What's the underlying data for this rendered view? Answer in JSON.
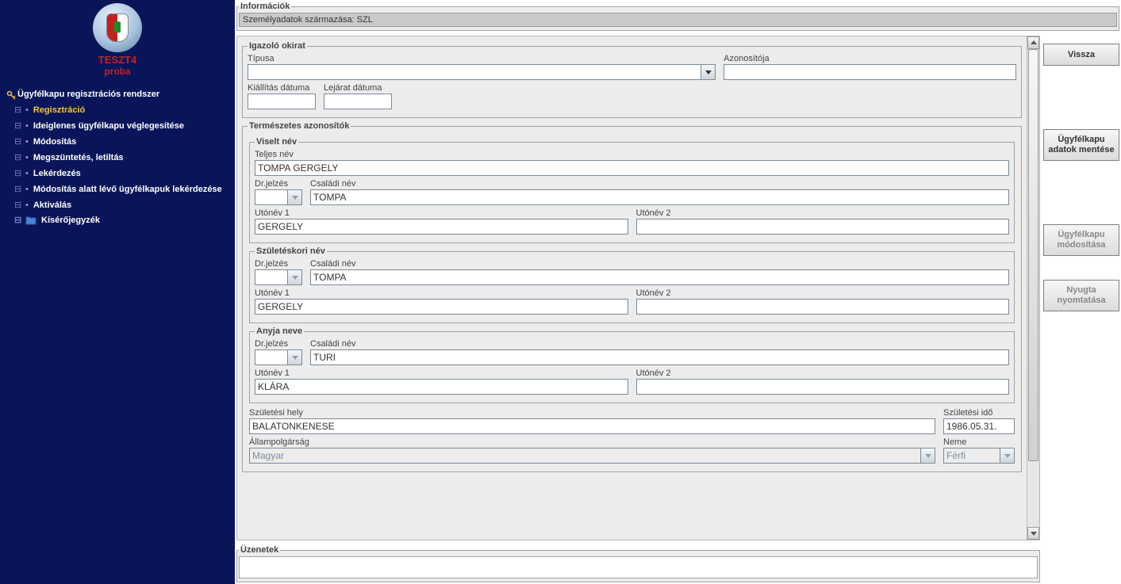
{
  "app": {
    "title1": "TESZT4",
    "title2": "proba"
  },
  "nav": {
    "root": "Ügyfélkapu regisztrációs rendszer",
    "items": [
      {
        "label": "Regisztráció",
        "current": true
      },
      {
        "label": "Ideiglenes ügyfélkapu véglegesítése"
      },
      {
        "label": "Módosítás"
      },
      {
        "label": "Megszüntetés, letiltás"
      },
      {
        "label": "Lekérdezés"
      },
      {
        "label": "Módosítás alatt lévő ügyfélkapuk lekérdezése"
      },
      {
        "label": "Aktiválás"
      }
    ],
    "folder": "Kísérőjegyzék"
  },
  "info": {
    "legend": "Információk",
    "text": "Személyadatok származása: SZL"
  },
  "form": {
    "igazolo": {
      "legend": "Igazoló okirat",
      "tipus_label": "Típusa",
      "tipus_value": "",
      "azonosito_label": "Azonosítója",
      "azonosito_value": "",
      "kiallitas_label": "Kiállítás dátuma",
      "kiallitas_value": "",
      "lejarat_label": "Lejárat dátuma",
      "lejarat_value": ""
    },
    "termeszetes": {
      "legend": "Természetes azonosítók",
      "viselt": {
        "legend": "Viselt név",
        "teljes_label": "Teljes név",
        "teljes_value": "TOMPA GERGELY",
        "dr_label": "Dr.jelzés",
        "dr_value": "",
        "csalad_label": "Családi név",
        "csalad_value": "TOMPA",
        "uto1_label": "Utónév 1",
        "uto1_value": "GERGELY",
        "uto2_label": "Utónév 2",
        "uto2_value": ""
      },
      "szuletesi": {
        "legend": "Születéskori név",
        "dr_label": "Dr.jelzés",
        "dr_value": "",
        "csalad_label": "Családi név",
        "csalad_value": "TOMPA",
        "uto1_label": "Utónév 1",
        "uto1_value": "GERGELY",
        "uto2_label": "Utónév 2",
        "uto2_value": ""
      },
      "anyja": {
        "legend": "Anyja neve",
        "dr_label": "Dr.jelzés",
        "dr_value": "",
        "csalad_label": "Családi név",
        "csalad_value": "TURI",
        "uto1_label": "Utónév 1",
        "uto1_value": "KLÁRA",
        "uto2_label": "Utónév 2",
        "uto2_value": ""
      },
      "hely_label": "Születési hely",
      "hely_value": "BALATONKENESE",
      "ido_label": "Születési idő",
      "ido_value": "1986.05.31.",
      "allam_label": "Állampolgárság",
      "allam_value": "Magyar",
      "neme_label": "Neme",
      "neme_value": "Férfi"
    }
  },
  "buttons": {
    "vissza": "Vissza",
    "mentes": "Ügyfélkapu adatok mentése",
    "modositas": "Ügyfélkapu módosítása",
    "nyugta": "Nyugta nyomtatása"
  },
  "messages": {
    "legend": "Üzenetek"
  }
}
